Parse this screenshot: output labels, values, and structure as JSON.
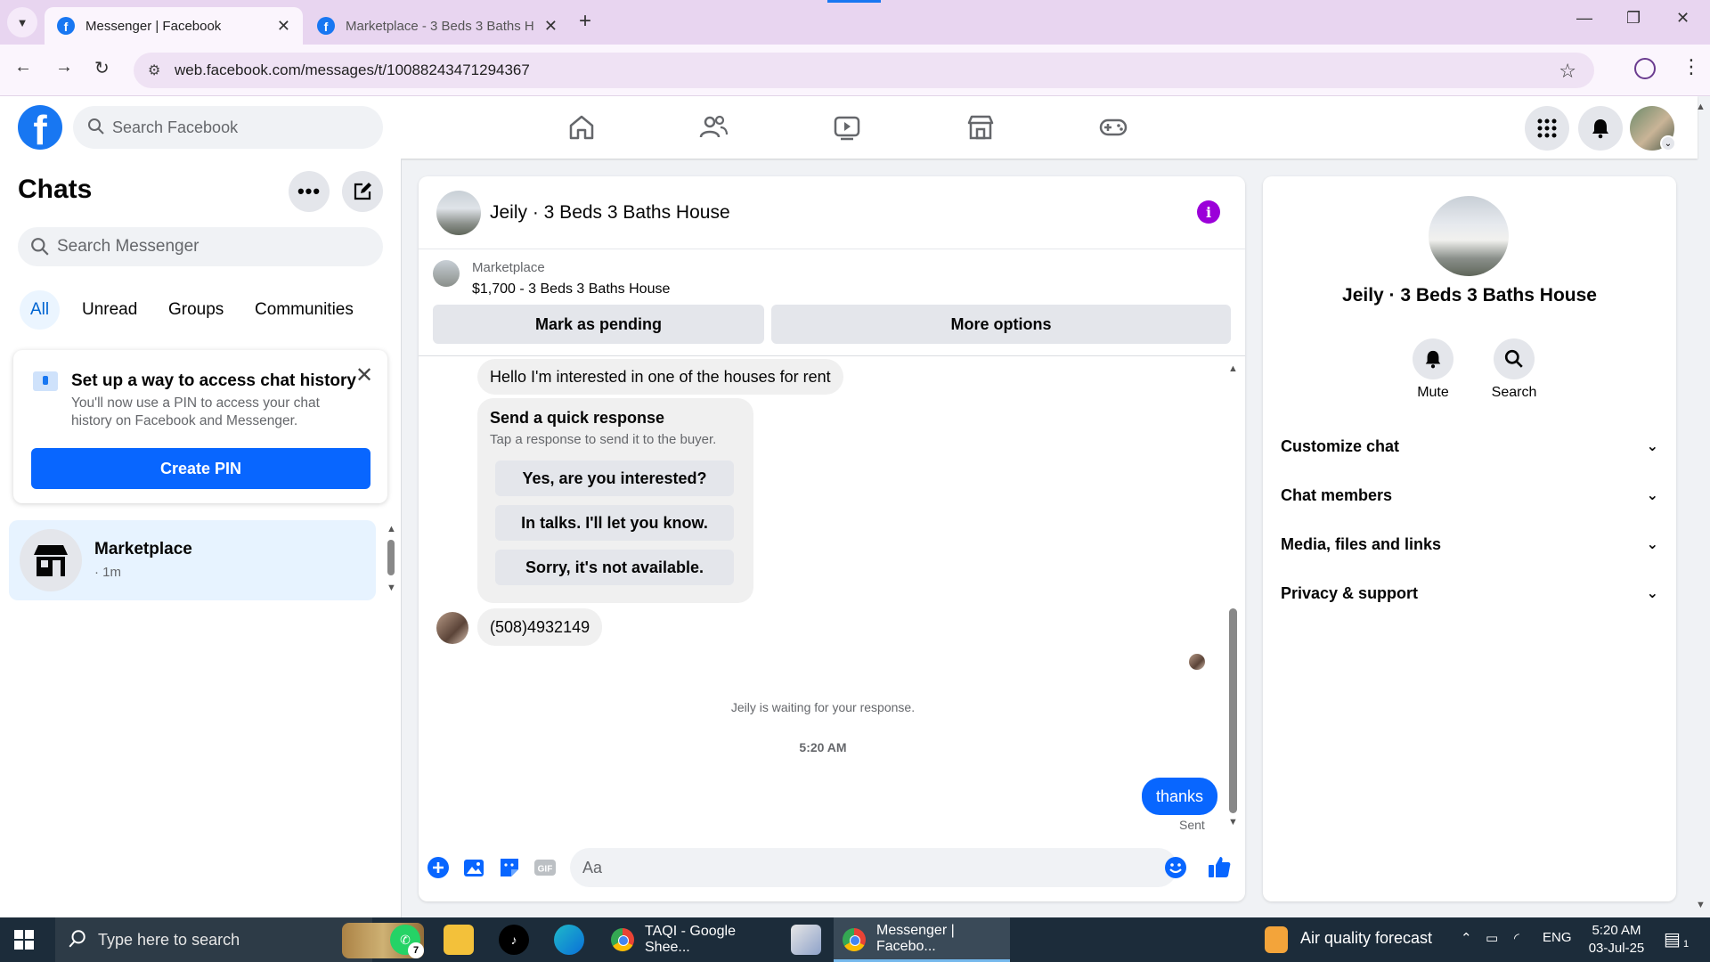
{
  "browser": {
    "tabs": [
      {
        "title": "Messenger | Facebook",
        "active": true
      },
      {
        "title": "Marketplace - 3 Beds 3 Baths H",
        "active": false
      }
    ],
    "url": "web.facebook.com/messages/t/10088243471294367"
  },
  "header": {
    "search_placeholder": "Search Facebook",
    "nav_icons": [
      "home-icon",
      "friends-icon",
      "video-icon",
      "marketplace-icon",
      "gaming-icon"
    ]
  },
  "sidebar": {
    "title": "Chats",
    "search_placeholder": "Search Messenger",
    "filters": [
      "All",
      "Unread",
      "Groups",
      "Communities"
    ],
    "selected_filter": "All",
    "pin_card": {
      "title": "Set up a way to access chat history",
      "description": "You'll now use a PIN to access your chat history on Facebook and Messenger.",
      "button": "Create PIN"
    },
    "conversations": [
      {
        "name": "Marketplace",
        "time": "· 1m"
      }
    ]
  },
  "chat": {
    "title": "Jeily · 3 Beds 3 Baths House",
    "marketplace_label": "Marketplace",
    "listing": "$1,700 - 3 Beds 3 Baths House",
    "actions": [
      "Mark as pending",
      "More options"
    ],
    "messages": {
      "inquiry": "Hello I'm interested in one of the houses for rent",
      "quick_title": "Send a quick response",
      "quick_sub": "Tap a response to send it to the buyer.",
      "quick_options": [
        "Yes, are you interested?",
        "In talks. I'll let you know.",
        "Sorry, it's not available."
      ],
      "phone": "(508)4932149",
      "waiting": "Jeily is waiting for your response.",
      "timestamp": "5:20 AM",
      "my_message": "thanks",
      "status": "Sent"
    },
    "composer_placeholder": "Aa"
  },
  "info_panel": {
    "name": "Jeily · 3 Beds 3 Baths House",
    "actions": [
      "Mute",
      "Search"
    ],
    "sections": [
      "Customize chat",
      "Chat members",
      "Media, files and links",
      "Privacy & support"
    ]
  },
  "taskbar": {
    "search_placeholder": "Type here to search",
    "whatsapp_badge": "7",
    "apps": [
      "TAQI - Google Shee...",
      "Messenger | Facebo..."
    ],
    "weather": "Air quality forecast",
    "language": "ENG",
    "time": "5:20 AM",
    "date": "03-Jul-25",
    "notification_count": "1"
  },
  "colors": {
    "facebook_blue": "#1877f2",
    "messenger_blue": "#0866ff",
    "info_purple": "#9b00d9",
    "browser_chrome": "#e8d5f0",
    "taskbar": "#1c2c3a"
  }
}
